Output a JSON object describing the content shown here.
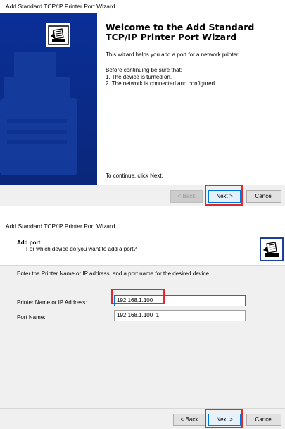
{
  "wizard1": {
    "window_title": "Add Standard TCP/IP Printer Port Wizard",
    "heading": "Welcome to the Add Standard TCP/IP Printer Port Wizard",
    "intro": "This wizard helps you add a port for a network printer.",
    "before_label": "Before continuing be sure that:",
    "checklist": [
      "1.  The device is turned on.",
      "2.  The network is connected and configured."
    ],
    "continue_text": "To continue, click Next.",
    "buttons": {
      "back": "< Back",
      "next": "Next >",
      "cancel": "Cancel"
    },
    "banner_icon": "printer-icon",
    "banner_color": "#0b2a86",
    "highlighted_button": "next"
  },
  "wizard2": {
    "window_title": "Add Standard TCP/IP Printer Port Wizard",
    "header_title": "Add port",
    "header_subtitle": "For which device do you want to add a port?",
    "instruction": "Enter the Printer Name or IP address, and a port name for the desired device.",
    "fields": {
      "printer_name": {
        "label": "Printer Name or IP Address:",
        "value": "192.168.1.100"
      },
      "port_name": {
        "label": "Port Name:",
        "value": "192.168.1.100_1"
      }
    },
    "buttons": {
      "back": "< Back",
      "next": "Next >",
      "cancel": "Cancel"
    },
    "header_icon": "printer-icon",
    "highlighted_elements": [
      "printer_name_field",
      "next"
    ],
    "highlight_color": "#e8262a"
  }
}
